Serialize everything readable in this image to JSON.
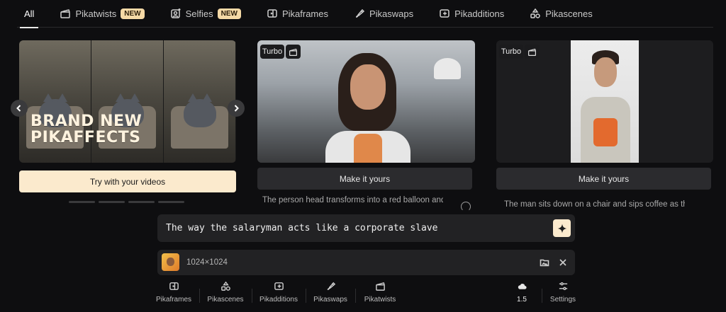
{
  "tabs": [
    {
      "label": "All",
      "icon": "none",
      "badge": ""
    },
    {
      "label": "Pikatwists",
      "icon": "clapper-icon",
      "badge": "NEW"
    },
    {
      "label": "Selfies",
      "icon": "selfie-icon",
      "badge": "NEW"
    },
    {
      "label": "Pikaframes",
      "icon": "frames-icon",
      "badge": ""
    },
    {
      "label": "Pikaswaps",
      "icon": "brush-icon",
      "badge": ""
    },
    {
      "label": "Pikadditions",
      "icon": "add-frame-icon",
      "badge": ""
    },
    {
      "label": "Pikascenes",
      "icon": "shapes-icon",
      "badge": ""
    }
  ],
  "cards": {
    "card1": {
      "banner_line1": "BRAND NEW",
      "banner_line2": "PIKAFFECTS",
      "cta": "Try with your videos"
    },
    "card2": {
      "chip": "Turbo",
      "cta": "Make it yours",
      "caption": "The person head transforms into a red balloon and fl"
    },
    "card3": {
      "chip": "Turbo",
      "cta": "Make it yours",
      "caption": "The man sits down on a chair and sips coffee as th"
    }
  },
  "prompt": {
    "text": "The way the salaryman acts like a corporate slave"
  },
  "attachment": {
    "size": "1024×1024"
  },
  "toolbar": [
    {
      "label": "Pikaframes",
      "icon": "frames-icon"
    },
    {
      "label": "Pikascenes",
      "icon": "shapes-icon"
    },
    {
      "label": "Pikadditions",
      "icon": "add-frame-icon"
    },
    {
      "label": "Pikaswaps",
      "icon": "brush-icon"
    },
    {
      "label": "Pikatwists",
      "icon": "clapper-icon"
    }
  ],
  "model": {
    "version": "1.5",
    "icon": "cloud-icon"
  },
  "settings": {
    "label": "Settings",
    "icon": "sliders-icon"
  },
  "colors": {
    "accent": "#fbeacd",
    "background": "#0e0e10",
    "panel": "#222224"
  }
}
